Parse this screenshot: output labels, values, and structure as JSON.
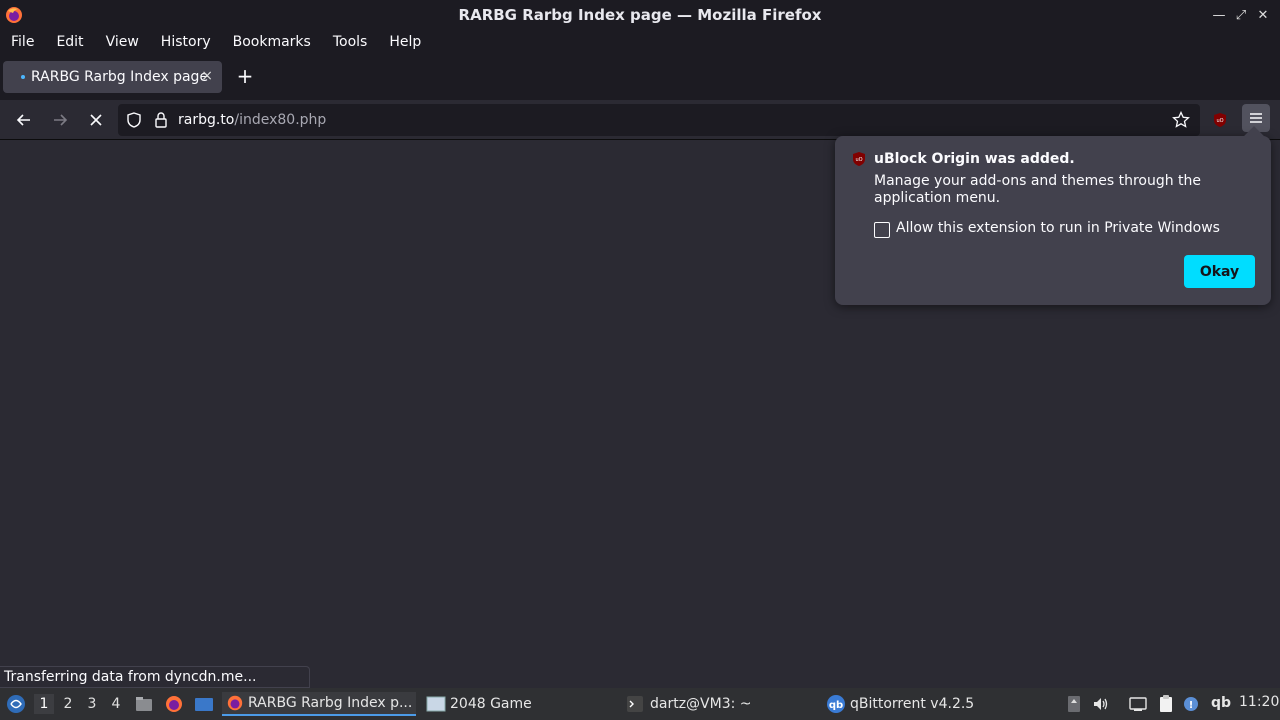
{
  "window": {
    "title": "RARBG Rarbg Index page — Mozilla Firefox"
  },
  "menubar": {
    "items": [
      "File",
      "Edit",
      "View",
      "History",
      "Bookmarks",
      "Tools",
      "Help"
    ]
  },
  "tabs": [
    {
      "label": "RARBG Rarbg Index page",
      "close": "×"
    }
  ],
  "newtab": {
    "symbol": "+"
  },
  "urlbar": {
    "host": "rarbg.to",
    "path": "/index80.php"
  },
  "popup": {
    "title": "uBlock Origin was added.",
    "text": "Manage your add-ons and themes through the application menu.",
    "checkbox_label": "Allow this extension to run in Private Windows",
    "checkbox_checked": false,
    "button": "Okay",
    "accent": "#00ddff"
  },
  "status": {
    "text": "Transferring data from dyncdn.me..."
  },
  "taskbar": {
    "workspaces": [
      "1",
      "2",
      "3",
      "4"
    ],
    "active_workspace": "1",
    "tasks": [
      {
        "label": "RARBG Rarbg Index p...",
        "icon": "firefox-icon",
        "active": true
      },
      {
        "label": "2048 Game",
        "icon": "window-icon",
        "active": false
      },
      {
        "label": "dartz@VM3: ~",
        "icon": "terminal-icon",
        "active": false
      },
      {
        "label": "qBittorrent v4.2.5",
        "icon": "qbittorrent-icon",
        "active": false
      }
    ],
    "clock": "11:20",
    "qb_tray": "qb"
  },
  "colors": {
    "chrome": "#1c1b22",
    "content": "#2b2a33",
    "popup": "#42414d",
    "taskbar": "#2f3033"
  }
}
